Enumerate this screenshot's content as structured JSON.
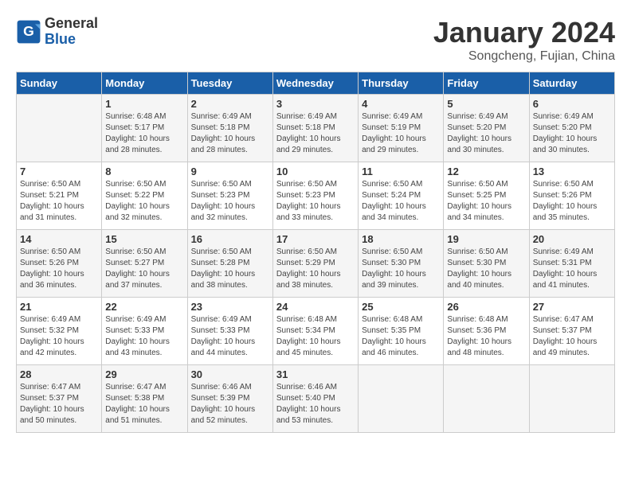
{
  "header": {
    "logo_line1": "General",
    "logo_line2": "Blue",
    "month": "January 2024",
    "location": "Songcheng, Fujian, China"
  },
  "columns": [
    "Sunday",
    "Monday",
    "Tuesday",
    "Wednesday",
    "Thursday",
    "Friday",
    "Saturday"
  ],
  "weeks": [
    [
      {
        "day": "",
        "info": ""
      },
      {
        "day": "1",
        "info": "Sunrise: 6:48 AM\nSunset: 5:17 PM\nDaylight: 10 hours\nand 28 minutes."
      },
      {
        "day": "2",
        "info": "Sunrise: 6:49 AM\nSunset: 5:18 PM\nDaylight: 10 hours\nand 28 minutes."
      },
      {
        "day": "3",
        "info": "Sunrise: 6:49 AM\nSunset: 5:18 PM\nDaylight: 10 hours\nand 29 minutes."
      },
      {
        "day": "4",
        "info": "Sunrise: 6:49 AM\nSunset: 5:19 PM\nDaylight: 10 hours\nand 29 minutes."
      },
      {
        "day": "5",
        "info": "Sunrise: 6:49 AM\nSunset: 5:20 PM\nDaylight: 10 hours\nand 30 minutes."
      },
      {
        "day": "6",
        "info": "Sunrise: 6:49 AM\nSunset: 5:20 PM\nDaylight: 10 hours\nand 30 minutes."
      }
    ],
    [
      {
        "day": "7",
        "info": "Sunrise: 6:50 AM\nSunset: 5:21 PM\nDaylight: 10 hours\nand 31 minutes."
      },
      {
        "day": "8",
        "info": "Sunrise: 6:50 AM\nSunset: 5:22 PM\nDaylight: 10 hours\nand 32 minutes."
      },
      {
        "day": "9",
        "info": "Sunrise: 6:50 AM\nSunset: 5:23 PM\nDaylight: 10 hours\nand 32 minutes."
      },
      {
        "day": "10",
        "info": "Sunrise: 6:50 AM\nSunset: 5:23 PM\nDaylight: 10 hours\nand 33 minutes."
      },
      {
        "day": "11",
        "info": "Sunrise: 6:50 AM\nSunset: 5:24 PM\nDaylight: 10 hours\nand 34 minutes."
      },
      {
        "day": "12",
        "info": "Sunrise: 6:50 AM\nSunset: 5:25 PM\nDaylight: 10 hours\nand 34 minutes."
      },
      {
        "day": "13",
        "info": "Sunrise: 6:50 AM\nSunset: 5:26 PM\nDaylight: 10 hours\nand 35 minutes."
      }
    ],
    [
      {
        "day": "14",
        "info": "Sunrise: 6:50 AM\nSunset: 5:26 PM\nDaylight: 10 hours\nand 36 minutes."
      },
      {
        "day": "15",
        "info": "Sunrise: 6:50 AM\nSunset: 5:27 PM\nDaylight: 10 hours\nand 37 minutes."
      },
      {
        "day": "16",
        "info": "Sunrise: 6:50 AM\nSunset: 5:28 PM\nDaylight: 10 hours\nand 38 minutes."
      },
      {
        "day": "17",
        "info": "Sunrise: 6:50 AM\nSunset: 5:29 PM\nDaylight: 10 hours\nand 38 minutes."
      },
      {
        "day": "18",
        "info": "Sunrise: 6:50 AM\nSunset: 5:30 PM\nDaylight: 10 hours\nand 39 minutes."
      },
      {
        "day": "19",
        "info": "Sunrise: 6:50 AM\nSunset: 5:30 PM\nDaylight: 10 hours\nand 40 minutes."
      },
      {
        "day": "20",
        "info": "Sunrise: 6:49 AM\nSunset: 5:31 PM\nDaylight: 10 hours\nand 41 minutes."
      }
    ],
    [
      {
        "day": "21",
        "info": "Sunrise: 6:49 AM\nSunset: 5:32 PM\nDaylight: 10 hours\nand 42 minutes."
      },
      {
        "day": "22",
        "info": "Sunrise: 6:49 AM\nSunset: 5:33 PM\nDaylight: 10 hours\nand 43 minutes."
      },
      {
        "day": "23",
        "info": "Sunrise: 6:49 AM\nSunset: 5:33 PM\nDaylight: 10 hours\nand 44 minutes."
      },
      {
        "day": "24",
        "info": "Sunrise: 6:48 AM\nSunset: 5:34 PM\nDaylight: 10 hours\nand 45 minutes."
      },
      {
        "day": "25",
        "info": "Sunrise: 6:48 AM\nSunset: 5:35 PM\nDaylight: 10 hours\nand 46 minutes."
      },
      {
        "day": "26",
        "info": "Sunrise: 6:48 AM\nSunset: 5:36 PM\nDaylight: 10 hours\nand 48 minutes."
      },
      {
        "day": "27",
        "info": "Sunrise: 6:47 AM\nSunset: 5:37 PM\nDaylight: 10 hours\nand 49 minutes."
      }
    ],
    [
      {
        "day": "28",
        "info": "Sunrise: 6:47 AM\nSunset: 5:37 PM\nDaylight: 10 hours\nand 50 minutes."
      },
      {
        "day": "29",
        "info": "Sunrise: 6:47 AM\nSunset: 5:38 PM\nDaylight: 10 hours\nand 51 minutes."
      },
      {
        "day": "30",
        "info": "Sunrise: 6:46 AM\nSunset: 5:39 PM\nDaylight: 10 hours\nand 52 minutes."
      },
      {
        "day": "31",
        "info": "Sunrise: 6:46 AM\nSunset: 5:40 PM\nDaylight: 10 hours\nand 53 minutes."
      },
      {
        "day": "",
        "info": ""
      },
      {
        "day": "",
        "info": ""
      },
      {
        "day": "",
        "info": ""
      }
    ]
  ]
}
